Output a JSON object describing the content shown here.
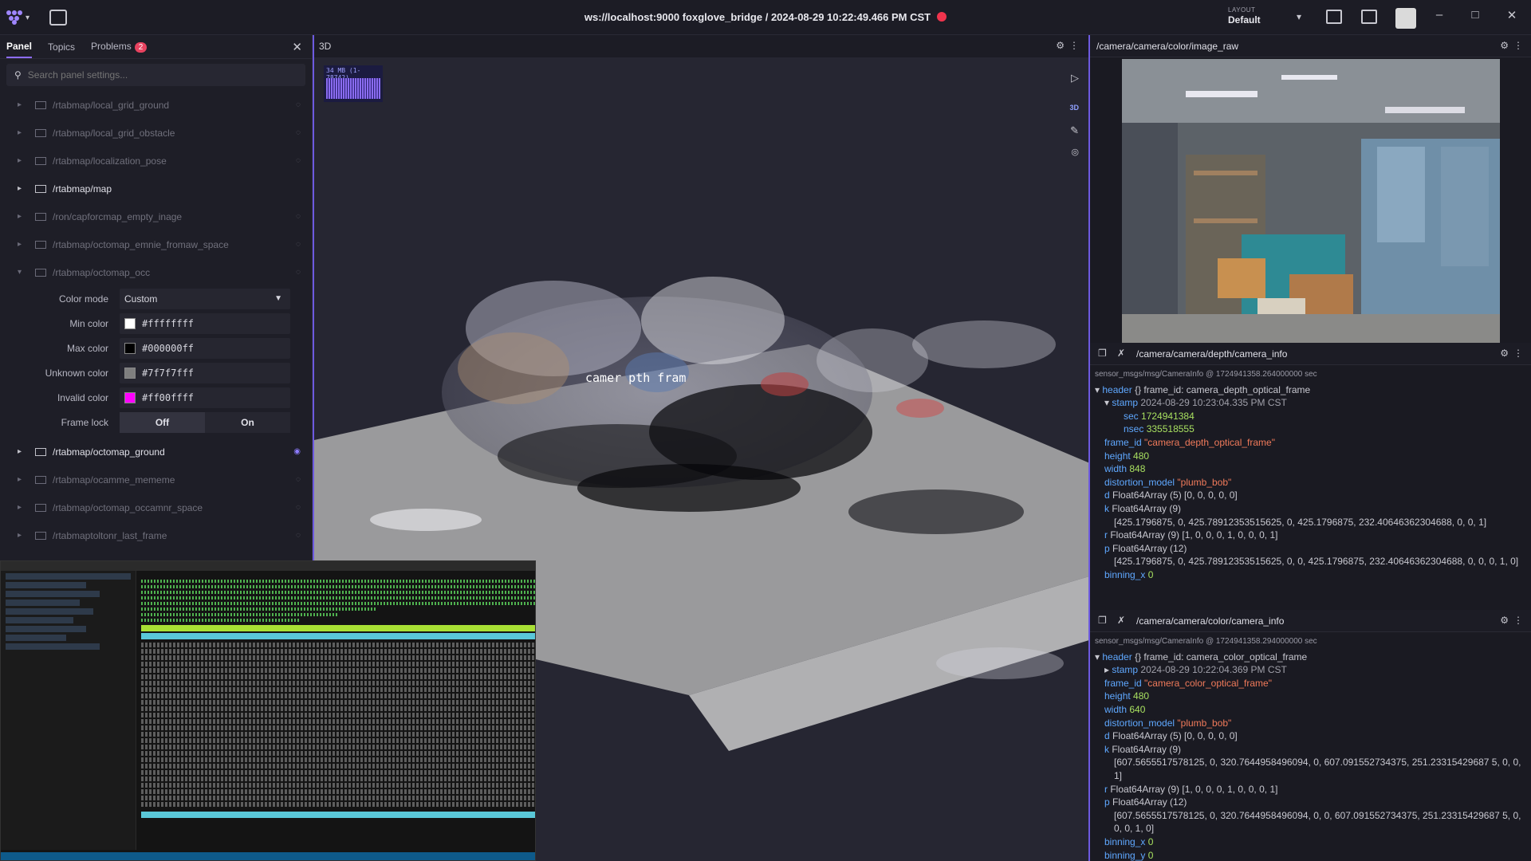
{
  "topbar": {
    "connection": "ws://localhost:9000 foxglove_bridge / 2024-08-29 10:22:49.466 PM CST",
    "layout_label": "LAYOUT",
    "layout_value": "Default"
  },
  "left_panel": {
    "tabs": [
      {
        "label": "Panel"
      },
      {
        "label": "Topics"
      },
      {
        "label": "Problems",
        "badge": "2"
      }
    ],
    "search_placeholder": "Search panel settings...",
    "topics_before": [
      {
        "name": "/rtabmap/local_grid_ground"
      },
      {
        "name": "/rtabmap/local_grid_obstacle"
      },
      {
        "name": "/rtabmap/localization_pose"
      },
      {
        "name": "/rtabmap/map"
      },
      {
        "name": "/ron/capforcmap_empty_inage"
      },
      {
        "name": "/rtabmap/octomap_emnie_fromaw_space"
      },
      {
        "name": "/rtabmap/octomap_occ"
      }
    ],
    "settings": {
      "color_mode_label": "Color mode",
      "color_mode_value": "Custom",
      "min_color_label": "Min color",
      "min_color_value": "#ffffffff",
      "min_color_swatch": "#ffffff",
      "max_color_label": "Max color",
      "max_color_value": "#000000ff",
      "max_color_swatch": "#000000",
      "unknown_color_label": "Unknown color",
      "unknown_color_value": "#7f7f7fff",
      "unknown_color_swatch": "#7f7f7f",
      "invalid_color_label": "Invalid color",
      "invalid_color_value": "#ff00ffff",
      "invalid_color_swatch": "#ff00ff",
      "frame_lock_label": "Frame lock",
      "frame_lock_off": "Off",
      "frame_lock_on": "On"
    },
    "topics_after": [
      {
        "name": "/rtabmap/octomap_ground"
      },
      {
        "name": "/rtabmap/ocamme_mememe"
      },
      {
        "name": "/rtabmap/octomap_occamnr_space"
      },
      {
        "name": "/rtabmaptoltonr_last_frame"
      }
    ]
  },
  "panel_3d": {
    "title": "3D",
    "fps_label": "34 MB (1-78742)",
    "view_mode": "3D",
    "frame_label": "camer   pth fram"
  },
  "image_panel": {
    "topic": "/camera/camera/color/image_raw"
  },
  "depth_info": {
    "topic": "/camera/camera/depth/camera_info",
    "meta": "sensor_msgs/msg/CameraInfo @ 1724941358.264000000 sec",
    "lines": [
      {
        "k": "header",
        "v": "{} frame_id: camera_depth_optical_frame"
      },
      {
        "k": "stamp",
        "v": "2024-08-29 10:23:04.335 PM CST"
      },
      {
        "k": "sec",
        "v": "1724941384"
      },
      {
        "k": "nsec",
        "v": "335518555"
      },
      {
        "k": "frame_id",
        "v": "\"camera_depth_optical_frame\""
      },
      {
        "k": "height",
        "v": "480"
      },
      {
        "k": "width",
        "v": "848"
      },
      {
        "k": "distortion_model",
        "v": "\"plumb_bob\""
      },
      {
        "k": "d",
        "v": "Float64Array (5) [0, 0, 0, 0, 0]"
      },
      {
        "k": "k",
        "v": "Float64Array (9)"
      },
      {
        "k": "",
        "v": "[425.1796875, 0, 425.78912353515625, 0, 425.1796875, 232.40646362304688, 0, 0, 1]"
      },
      {
        "k": "r",
        "v": "Float64Array (9) [1, 0, 0, 0, 1, 0, 0, 0, 1]"
      },
      {
        "k": "p",
        "v": "Float64Array (12)"
      },
      {
        "k": "",
        "v": "[425.1796875, 0, 425.78912353515625, 0, 0, 425.1796875, 232.40646362304688, 0, 0, 0, 1, 0]"
      },
      {
        "k": "binning_x",
        "v": "0"
      }
    ]
  },
  "color_info": {
    "topic": "/camera/camera/color/camera_info",
    "meta": "sensor_msgs/msg/CameraInfo @ 1724941358.294000000 sec",
    "lines": [
      {
        "k": "header",
        "v": "{} frame_id: camera_color_optical_frame"
      },
      {
        "k": "stamp",
        "v": "2024-08-29 10:22:04.369 PM CST"
      },
      {
        "k": "frame_id",
        "v": "\"camera_color_optical_frame\""
      },
      {
        "k": "height",
        "v": "480"
      },
      {
        "k": "width",
        "v": "640"
      },
      {
        "k": "distortion_model",
        "v": "\"plumb_bob\""
      },
      {
        "k": "d",
        "v": "Float64Array (5) [0, 0, 0, 0, 0]"
      },
      {
        "k": "k",
        "v": "Float64Array (9)"
      },
      {
        "k": "",
        "v": "[607.5655517578125, 0, 320.7644958496094, 0, 607.091552734375, 251.23315429687 5, 0, 0, 1]"
      },
      {
        "k": "r",
        "v": "Float64Array (9) [1, 0, 0, 0, 1, 0, 0, 0, 1]"
      },
      {
        "k": "p",
        "v": "Float64Array (12)"
      },
      {
        "k": "",
        "v": "[607.5655517578125, 0, 320.7644958496094, 0, 0, 607.091552734375, 251.23315429687 5, 0, 0, 0, 1, 0]"
      },
      {
        "k": "binning_x",
        "v": "0"
      },
      {
        "k": "binning_y",
        "v": "0"
      }
    ]
  },
  "colors": {
    "accent": "#6d5ae0",
    "record": "#f0344d",
    "key": "#5fa8ff",
    "string": "#f07a5a",
    "number": "#a8e060"
  }
}
